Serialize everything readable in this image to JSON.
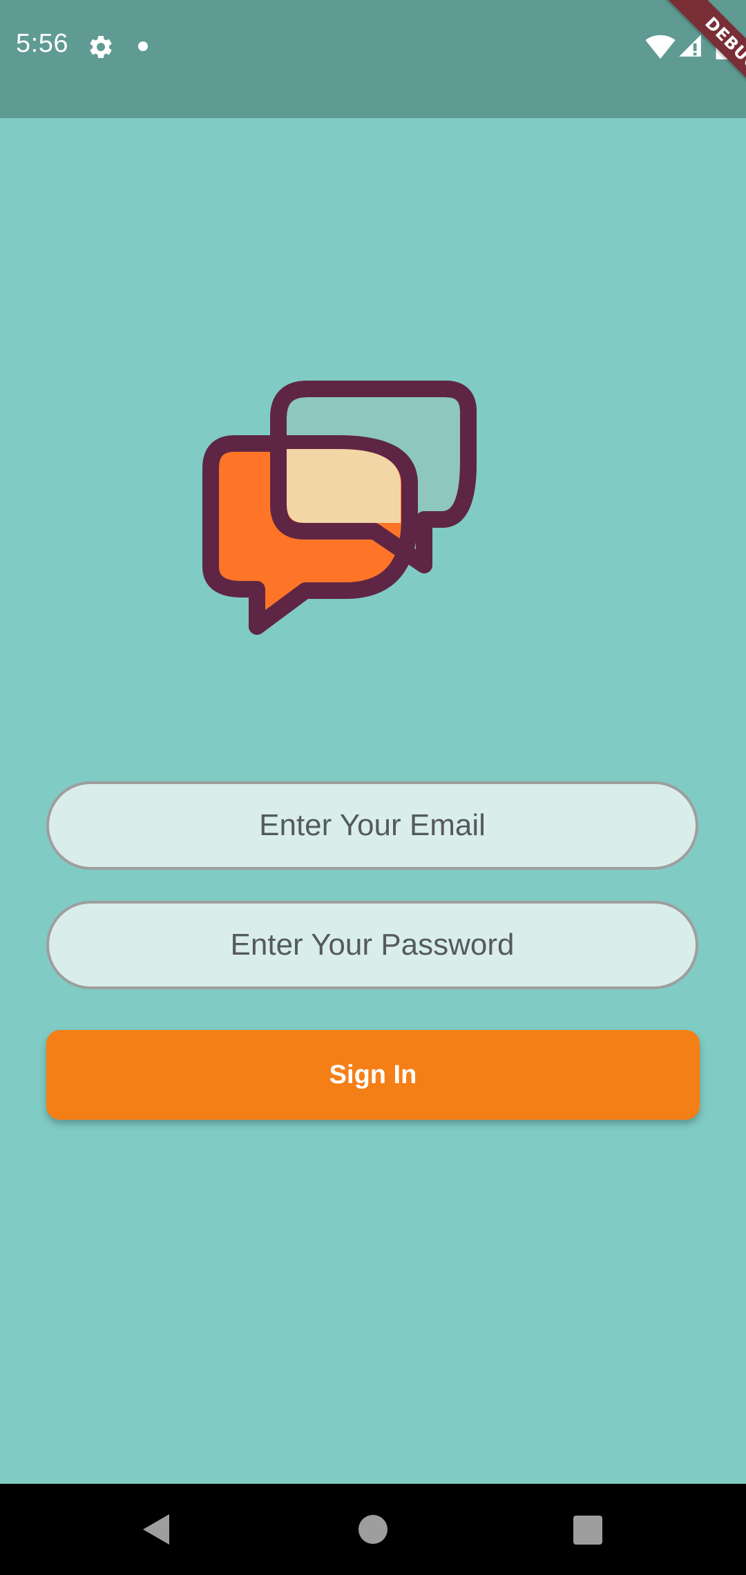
{
  "status_bar": {
    "time": "5:56",
    "icons": [
      "gear-icon",
      "notification-dot-icon",
      "wifi-icon",
      "signal-icon",
      "battery-icon"
    ]
  },
  "debug_banner": {
    "label": "DEBUG"
  },
  "logo": {
    "icon": "chat-bubbles-icon",
    "colors": {
      "outline": "#5E2644",
      "front_bubble": "#FF7527",
      "back_bubble": "#8DC7C0",
      "overlap": "#F3D6A5"
    }
  },
  "login_form": {
    "email_placeholder": "Enter Your Email",
    "password_placeholder": "Enter Your Password",
    "sign_in_label": "Sign In"
  },
  "nav_bar": {
    "icons": [
      "back-icon",
      "home-icon",
      "recents-icon"
    ]
  },
  "colors": {
    "background": "#80CBC4",
    "status_bar": "#5F9B93",
    "field_fill": "#D9EEEB",
    "field_border": "#9E9E9E",
    "button": "#F57F17"
  }
}
